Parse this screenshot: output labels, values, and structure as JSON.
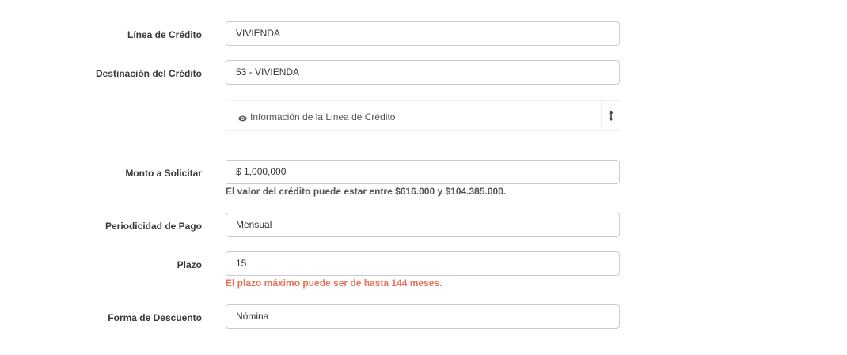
{
  "form": {
    "linea_credito": {
      "label": "Línea de Crédito",
      "value": "VIVIENDA"
    },
    "destinacion": {
      "label": "Destinación del Crédito",
      "value": "53 - VIVIENDA"
    },
    "info_panel": {
      "text": "Información de la Linea de Crédito",
      "icon": "eye-icon",
      "toggle_icon": "vertical-resize-arrow-icon"
    },
    "monto": {
      "label": "Monto a Solicitar",
      "value": "$ 1,000,000",
      "help": "El valor del crédito puede estar entre $616.000 y $104.385.000."
    },
    "periodicidad": {
      "label": "Periodicidad de Pago",
      "value": "Mensual"
    },
    "plazo": {
      "label": "Plazo",
      "value": "15",
      "help": "El plazo máximo puede ser de hasta 144 meses."
    },
    "forma_descuento": {
      "label": "Forma de Descuento",
      "value": "Nómina"
    }
  },
  "colors": {
    "warning_text": "#e8735a",
    "help_text": "#555555",
    "border": "#cccccc"
  }
}
